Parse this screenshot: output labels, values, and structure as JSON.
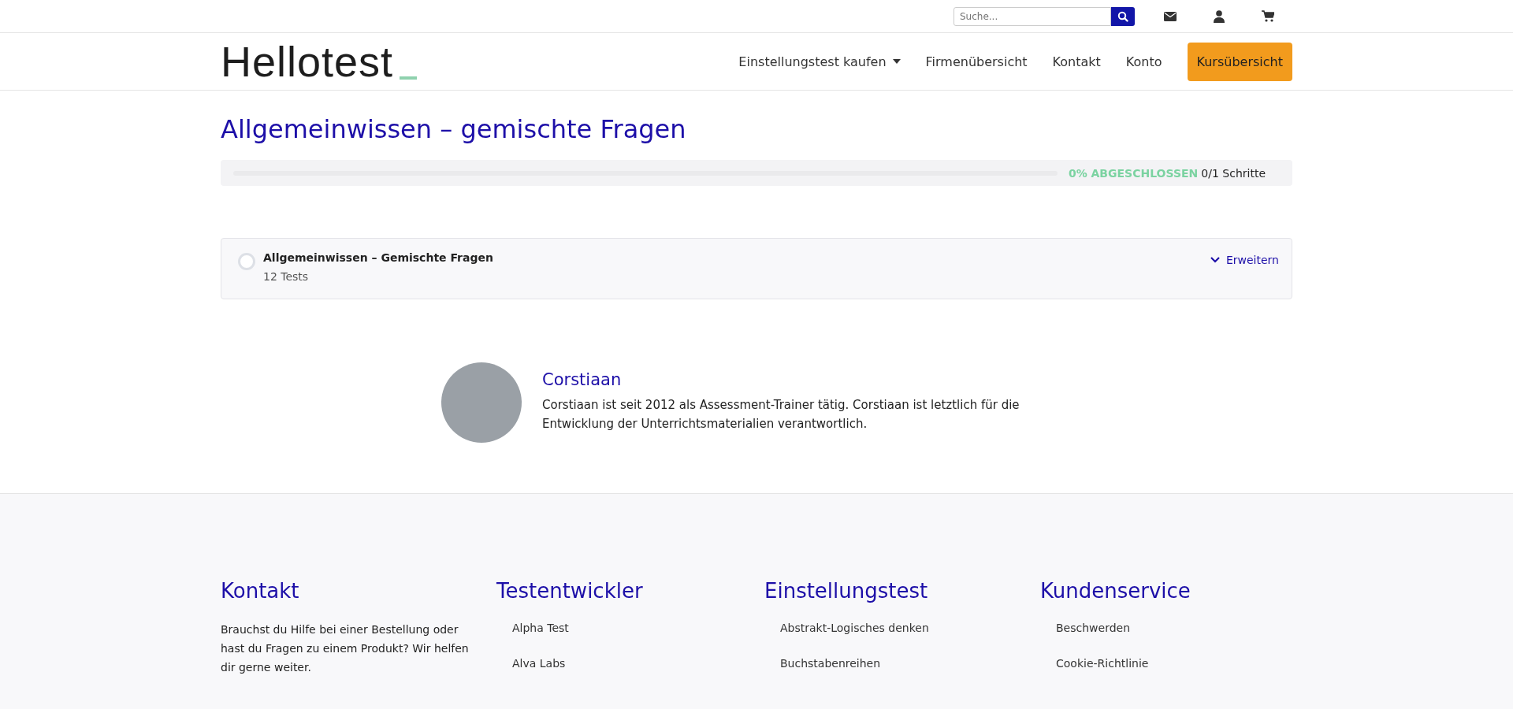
{
  "topbar": {
    "search": {
      "placeholder": "Suche..."
    }
  },
  "header": {
    "logo": "Hellotest",
    "nav": [
      {
        "label": "Einstellungstest kaufen",
        "kind": "dropdown"
      },
      {
        "label": "Firmenübersicht",
        "kind": "link"
      },
      {
        "label": "Kontakt",
        "kind": "link"
      },
      {
        "label": "Konto",
        "kind": "link"
      },
      {
        "label": "Kursübersicht",
        "kind": "button"
      }
    ]
  },
  "course": {
    "title": "Allgemeinwissen – gemischte Fragen",
    "progress": {
      "level": 0,
      "percent": "0% ABGESCHLOSSEN",
      "steps": "0/1 Schritte"
    },
    "sections": [
      {
        "title": "Allgemeinwissen – Gemischte Fragen",
        "count": "12 Tests",
        "checked": false,
        "expand": "Erweitern"
      }
    ]
  },
  "author": {
    "name": "Corstiaan",
    "bio": "Corstiaan ist seit 2012 als Assessment-Trainer tätig. Corstiaan ist letztlich für die Entwicklung der Unterrichtsmaterialien verantwortlich."
  },
  "footer": {
    "columns": [
      {
        "heading": "Kontakt",
        "kind": "text",
        "text": "Brauchst du Hilfe bei einer Bestellung oder hast du Fragen zu einem Produkt? Wir helfen dir gerne weiter."
      },
      {
        "heading": "Testentwickler",
        "kind": "links",
        "links": [
          "Alpha Test",
          "Alva Labs"
        ]
      },
      {
        "heading": "Einstellungstest",
        "kind": "links",
        "links": [
          "Abstrakt-Logisches denken",
          "Buchstabenreihen"
        ]
      },
      {
        "heading": "Kundenservice",
        "kind": "links",
        "links": [
          "Beschwerden",
          "Cookie-Richtlinie"
        ]
      }
    ]
  }
}
